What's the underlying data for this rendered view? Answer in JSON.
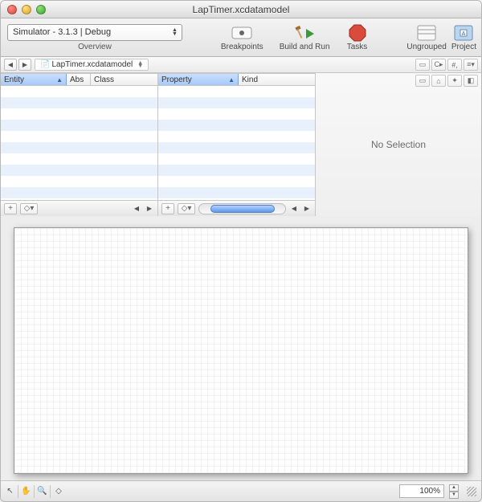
{
  "window": {
    "title": "LapTimer.xcdatamodel"
  },
  "toolbar": {
    "scheme": "Simulator - 3.1.3 | Debug",
    "scheme_label": "Overview",
    "breakpoints": "Breakpoints",
    "build_run": "Build and Run",
    "tasks": "Tasks",
    "ungrouped": "Ungrouped",
    "project": "Project"
  },
  "pathbar": {
    "crumb": "LapTimer.xcdatamodel"
  },
  "entity_table": {
    "cols": {
      "c0": "Entity",
      "c1": "Abs",
      "c2": "Class"
    }
  },
  "property_table": {
    "cols": {
      "c0": "Property",
      "c1": "Kind"
    }
  },
  "detail": {
    "no_selection": "No Selection"
  },
  "status": {
    "zoom": "100%"
  }
}
